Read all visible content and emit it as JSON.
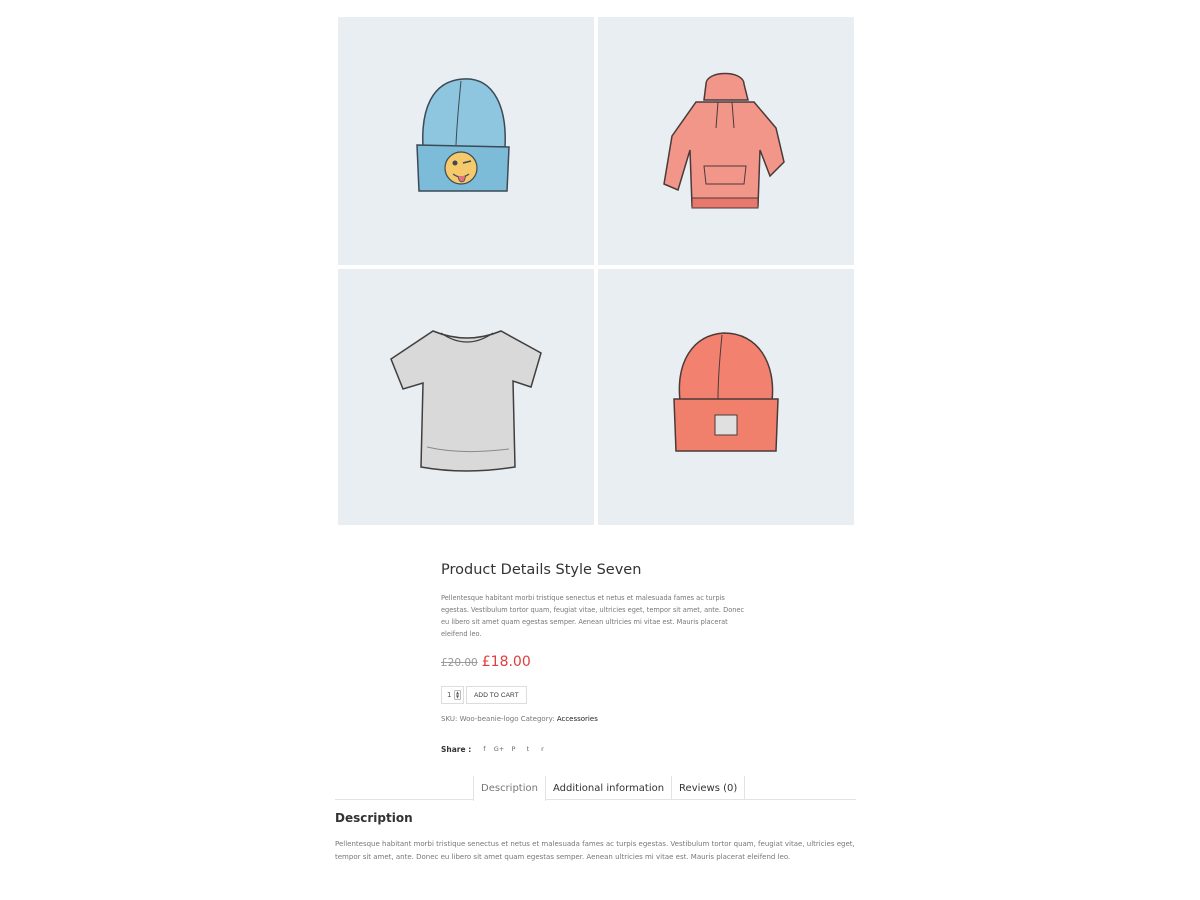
{
  "gallery": {
    "images": [
      {
        "name": "Blue beanie with winking emoji logo",
        "color": "#8dc6de"
      },
      {
        "name": "Coral hoodie",
        "color": "#f2968a"
      },
      {
        "name": "Grey t-shirt",
        "color": "#d9d9d9"
      },
      {
        "name": "Coral beanie with grey patch",
        "color": "#f2826f"
      }
    ]
  },
  "product": {
    "title": "Product Details Style Seven",
    "short_description": "Pellentesque habitant morbi tristique senectus et netus et malesuada fames ac turpis egestas. Vestibulum tortor quam, feugiat vitae, ultricies eget, tempor sit amet, ante. Donec eu libero sit amet quam egestas semper. Aenean ultricies mi vitae est. Mauris placerat eleifend leo.",
    "price_old": "£20.00",
    "price_new": "£18.00",
    "quantity": "1",
    "add_to_cart_label": "ADD TO CART",
    "sku_label": "SKU:",
    "sku_value": "Woo-beanie-logo",
    "category_label": "Category:",
    "category_value": "Accessories"
  },
  "share": {
    "label": "Share :",
    "icons": {
      "facebook": "f",
      "google_plus": "G+",
      "pinterest": "P",
      "twitter": "t",
      "reddit": "r"
    }
  },
  "tabs": [
    {
      "label": "Description",
      "active": true
    },
    {
      "label": "Additional information",
      "active": false
    },
    {
      "label": "Reviews (0)",
      "active": false
    }
  ],
  "description": {
    "heading": "Description",
    "body": "Pellentesque habitant morbi tristique senectus et netus et malesuada fames ac turpis egestas. Vestibulum tortor quam, feugiat vitae, ultricies eget, tempor sit amet, ante. Donec eu libero sit amet quam egestas semper. Aenean ultricies mi vitae est. Mauris placerat eleifend leo."
  },
  "colors": {
    "sale_price": "#e03d3d",
    "tile_background": "#e9eef2",
    "link": "#222222"
  }
}
